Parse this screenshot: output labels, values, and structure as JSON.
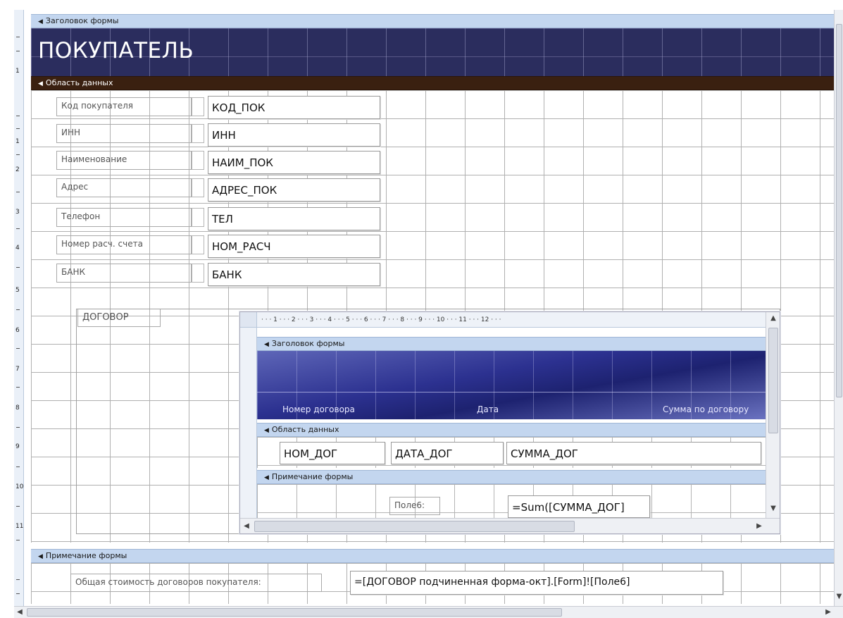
{
  "main_form": {
    "sections": {
      "header": "Заголовок формы",
      "detail": "Область данных",
      "footer": "Примечание формы"
    },
    "title": "ПОКУПАТЕЛЬ",
    "fields": [
      {
        "label": "Код покупателя",
        "value": "КОД_ПОК"
      },
      {
        "label": "ИНН",
        "value": "ИНН"
      },
      {
        "label": "Наименование",
        "value": "НАИМ_ПОК"
      },
      {
        "label": "Адрес",
        "value": "АДРЕС_ПОК"
      },
      {
        "label": "Телефон",
        "value": "ТЕЛ"
      },
      {
        "label": "Номер расч. счета",
        "value": "НОМ_РАСЧ"
      },
      {
        "label": "БАНК",
        "value": "БАНК"
      }
    ],
    "subform_label": "ДОГОВОР",
    "footer_label": "Общая стоимость договоров покупателя:",
    "footer_value": "=[ДОГОВОР подчиненная форма-окт].[Form]![Поле6]"
  },
  "subform": {
    "ruler": "· · · 1 · · · 2 · · · 3 · · · 4 · · · 5 · · · 6 · · · 7 · · · 8 · · · 9 · · · 10 · · · 11 · · · 12 · · ·",
    "sections": {
      "header": "Заголовок формы",
      "detail": "Область данных",
      "footer": "Примечание формы"
    },
    "column_headers": [
      "Номер договора",
      "Дата",
      "Сумма по договору"
    ],
    "fields": [
      "НОМ_ДОГ",
      "ДАТА_ДОГ",
      "СУММА_ДОГ"
    ],
    "footer_label": "Поле6:",
    "footer_value": "=Sum([СУММА_ДОГ]"
  },
  "left_ruler_numbers": [
    "1",
    "1",
    "2",
    "3",
    "4",
    "5",
    "6",
    "7",
    "8",
    "9",
    "10",
    "11"
  ],
  "icons": {
    "section_marker": "section-marker-icon",
    "scroll_up": "scroll-up-arrow-icon",
    "scroll_down": "scroll-down-arrow-icon",
    "scroll_left": "scroll-left-arrow-icon",
    "scroll_right": "scroll-right-arrow-icon"
  },
  "colors": {
    "section_bar": "#c3d6ef",
    "detail_bar_main": "#3a2010",
    "header_band": "#2b2d5e",
    "grid_line": "#b0b0b0"
  }
}
